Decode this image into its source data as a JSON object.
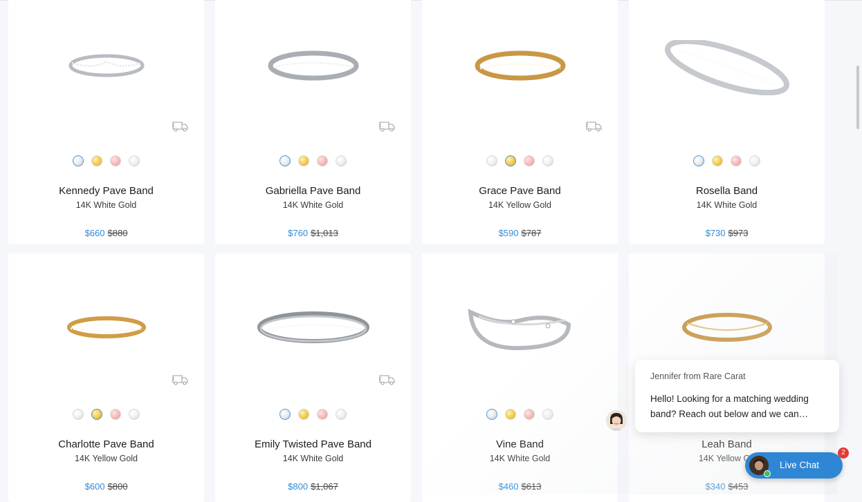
{
  "products": [
    {
      "name": "Kennedy Pave Band",
      "metal": "14K White Gold",
      "price": "$660",
      "original_price": "$880",
      "swatches": [
        "white",
        "yellow",
        "rose",
        "plat"
      ],
      "selected": 0,
      "shipping": true,
      "ring": "white-notched"
    },
    {
      "name": "Gabriella Pave Band",
      "metal": "14K White Gold",
      "price": "$760",
      "original_price": "$1,013",
      "swatches": [
        "white",
        "yellow",
        "rose",
        "plat"
      ],
      "selected": 0,
      "shipping": true,
      "ring": "white-curved"
    },
    {
      "name": "Grace Pave Band",
      "metal": "14K Yellow Gold",
      "price": "$590",
      "original_price": "$787",
      "swatches": [
        "plat",
        "yellow",
        "rose",
        "plat"
      ],
      "selected": 1,
      "shipping": true,
      "ring": "yellow-curved"
    },
    {
      "name": "Rosella Band",
      "metal": "14K White Gold",
      "price": "$730",
      "original_price": "$973",
      "swatches": [
        "white",
        "yellow",
        "rose",
        "plat"
      ],
      "selected": 0,
      "shipping": false,
      "ring": "white-angled"
    },
    {
      "name": "Charlotte Pave Band",
      "metal": "14K Yellow Gold",
      "price": "$600",
      "original_price": "$800",
      "swatches": [
        "plat",
        "yellow",
        "rose",
        "plat"
      ],
      "selected": 1,
      "shipping": true,
      "ring": "yellow-straight"
    },
    {
      "name": "Emily Twisted Pave Band",
      "metal": "14K White Gold",
      "price": "$800",
      "original_price": "$1,067",
      "swatches": [
        "white",
        "yellow",
        "rose",
        "plat"
      ],
      "selected": 0,
      "shipping": true,
      "ring": "white-twisted"
    },
    {
      "name": "Vine Band",
      "metal": "14K White Gold",
      "price": "$460",
      "original_price": "$613",
      "swatches": [
        "white",
        "yellow",
        "rose",
        "plat"
      ],
      "selected": 0,
      "shipping": false,
      "ring": "white-vine"
    },
    {
      "name": "Leah Band",
      "metal": "14K Yellow Go",
      "price": "$340",
      "original_price": "$453",
      "swatches": [],
      "selected": -1,
      "shipping": false,
      "ring": "yellow-plain"
    }
  ],
  "chat": {
    "from": "Jennifer from Rare Carat",
    "message": "Hello! Looking for a matching wedding band? Reach out below and we can…",
    "button_label": "Live Chat",
    "unread_count": "2"
  },
  "icons": {
    "shipping": "truck-icon",
    "chat_avatar": "agent-avatar-icon"
  },
  "colors": {
    "price": "#2f8ad8",
    "chat_button": "#2f86d4",
    "badge": "#e53935"
  }
}
